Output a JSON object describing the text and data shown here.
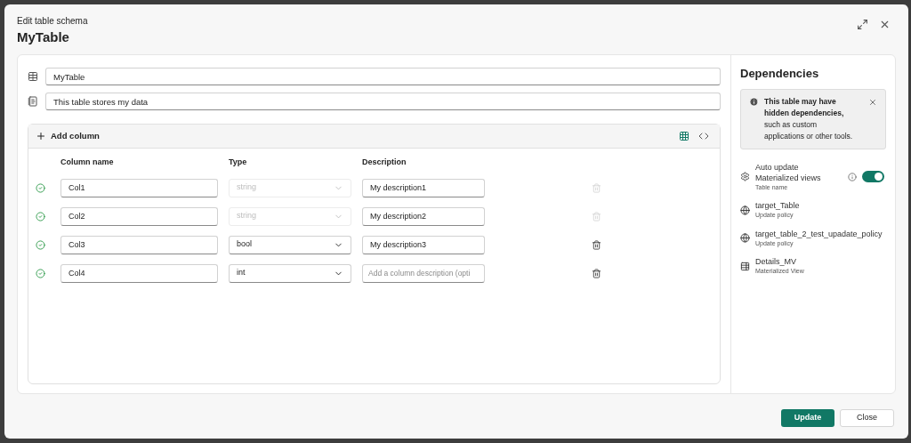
{
  "dialog": {
    "subtitle": "Edit table schema",
    "title": "MyTable"
  },
  "table_name": {
    "value": "MyTable"
  },
  "table_description": {
    "value": "This table stores my data"
  },
  "toolbar": {
    "add_column": "Add column",
    "grid_view_selected": true
  },
  "columns_header": [
    "Column name",
    "Type",
    "Description"
  ],
  "rows": [
    {
      "valid": true,
      "name": "Col1",
      "type": "string",
      "locked": true,
      "description": "My description1"
    },
    {
      "valid": true,
      "name": "Col2",
      "type": "string",
      "locked": true,
      "description": "My description2"
    },
    {
      "valid": true,
      "name": "Col3",
      "type": "bool",
      "locked": false,
      "description": "My description3"
    },
    {
      "valid": true,
      "name": "Col4",
      "type": "int",
      "locked": false,
      "description_placeholder": "Add a column description (opti"
    }
  ],
  "dependencies": {
    "title": "Dependencies",
    "notice": "**This table may have hidden dependencies,** such as custom applications or other tools.",
    "auto_update": {
      "label": "Auto update Materialized views",
      "sub": "Table name",
      "on": true
    },
    "items": [
      {
        "kind": "policy",
        "name": "target_Table",
        "sub": "Update policy"
      },
      {
        "kind": "policy",
        "name": "target_table_2_test_upadate_policy",
        "sub": "Update policy"
      },
      {
        "kind": "view",
        "name": "Details_MV",
        "sub": "Materialized View"
      }
    ]
  },
  "buttons": {
    "primary": "Update",
    "secondary": "Close"
  }
}
